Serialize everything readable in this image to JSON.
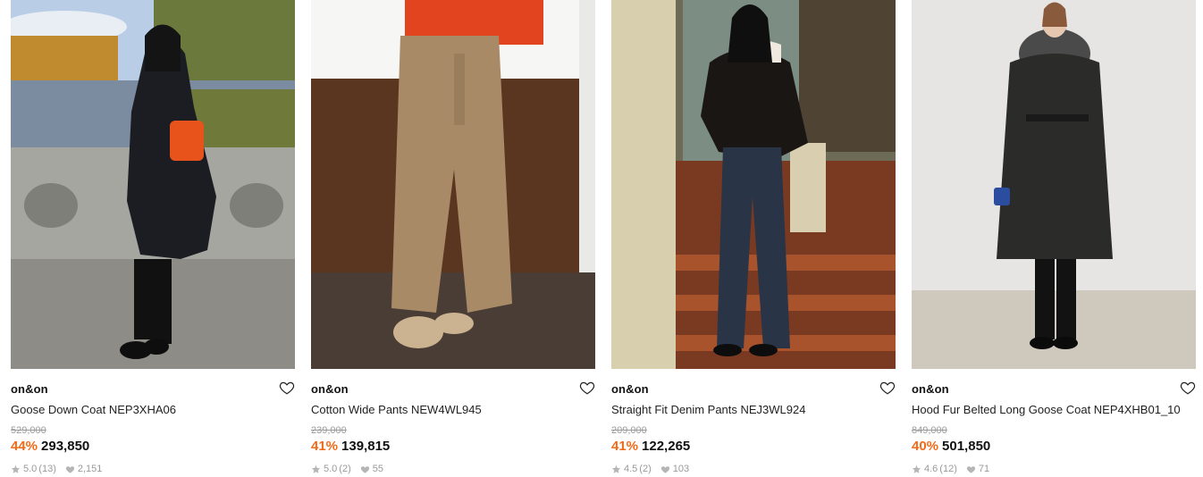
{
  "products": [
    {
      "brand": "on&on",
      "name": "Goose Down Coat NEP3XHA06",
      "original_price": "529,000",
      "discount": "44%",
      "price": "293,850",
      "rating": "5.0",
      "reviews": "(13)",
      "likes": "2,151"
    },
    {
      "brand": "on&on",
      "name": "Cotton Wide Pants NEW4WL945",
      "original_price": "239,000",
      "discount": "41%",
      "price": "139,815",
      "rating": "5.0",
      "reviews": "(2)",
      "likes": "55"
    },
    {
      "brand": "on&on",
      "name": "Straight Fit Denim Pants NEJ3WL924",
      "original_price": "209,000",
      "discount": "41%",
      "price": "122,265",
      "rating": "4.5",
      "reviews": "(2)",
      "likes": "103"
    },
    {
      "brand": "on&on",
      "name": "Hood Fur Belted Long Goose Coat NEP4XHB01_10",
      "original_price": "849,000",
      "discount": "40%",
      "price": "501,850",
      "rating": "4.6",
      "reviews": "(12)",
      "likes": "71"
    }
  ],
  "icons": {
    "wishlist": "heart-outline-icon",
    "rating": "star-icon",
    "likes": "heart-filled-icon"
  },
  "colors": {
    "discount": "#f26a17",
    "muted": "#9a9a9a"
  }
}
